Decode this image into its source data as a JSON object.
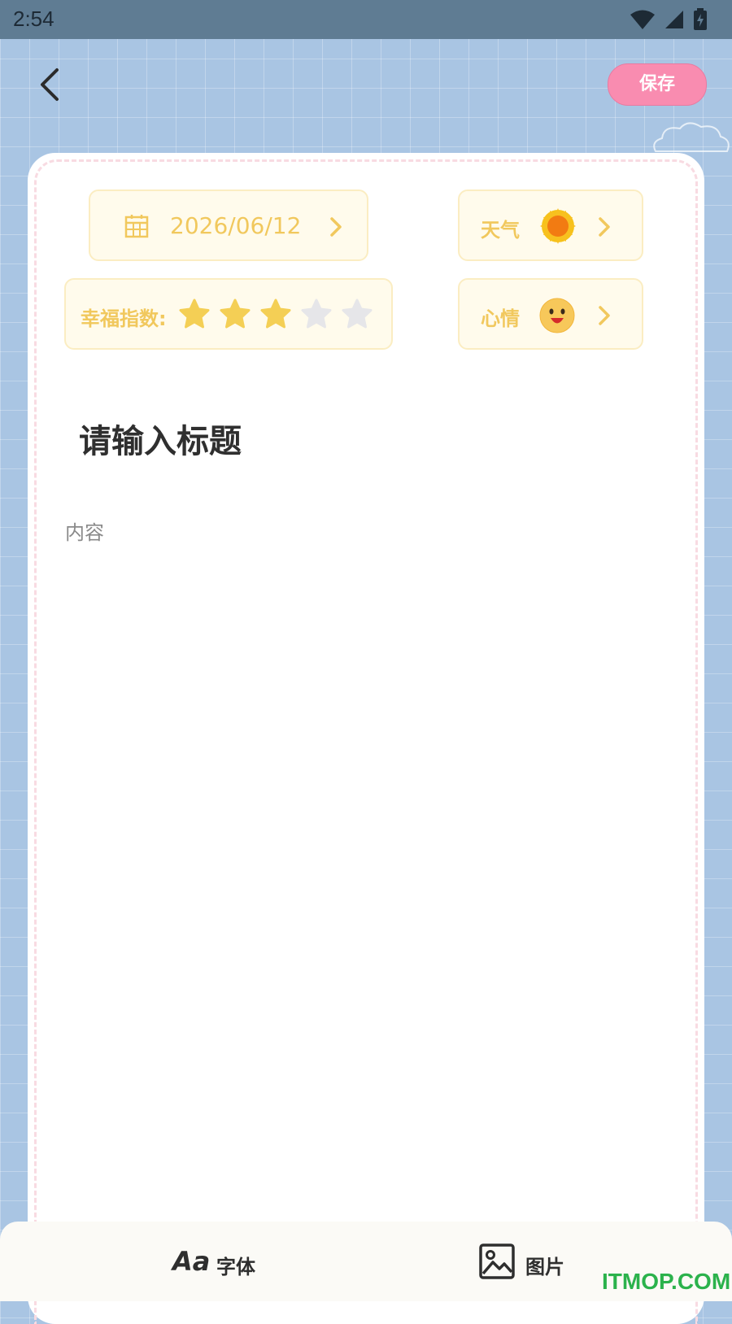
{
  "status_bar": {
    "time": "2:54",
    "icons": [
      "wifi-icon",
      "signal-icon",
      "battery-icon"
    ]
  },
  "header": {
    "back_icon": "chevron-left-icon",
    "save_label": "保存"
  },
  "meta": {
    "date": "2026/06/12",
    "weather_label": "天气",
    "weather_icon": "sun-icon",
    "happiness_label": "幸福指数:",
    "happiness_rating": 3,
    "happiness_max": 5,
    "mood_label": "心情",
    "mood_icon": "smiley-face-icon"
  },
  "editor": {
    "title_placeholder": "请输入标题",
    "content_placeholder": "内容"
  },
  "toolbar": {
    "font_label": "字体",
    "font_icon_text": "Aa",
    "image_label": "图片"
  },
  "watermark": "ITMOP.COM",
  "colors": {
    "accent_yellow": "#f1c85d",
    "save_pink": "#f98cb0",
    "background_blue": "#a9c5e3"
  }
}
